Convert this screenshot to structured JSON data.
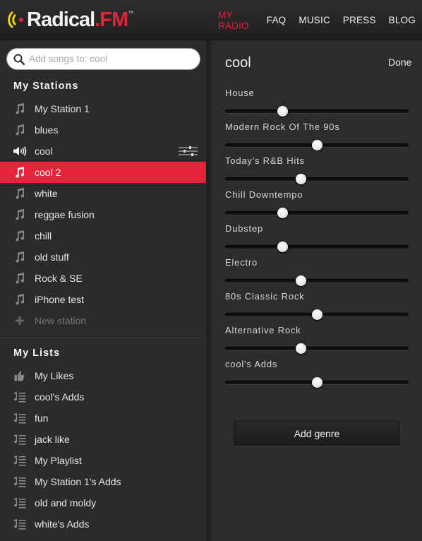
{
  "header": {
    "logo": {
      "name": "Radical",
      "suffix": ".FM",
      "tm": "™"
    },
    "nav": [
      {
        "label": "MY RADIO",
        "active": true
      },
      {
        "label": "FAQ",
        "active": false
      },
      {
        "label": "MUSIC",
        "active": false
      },
      {
        "label": "PRESS",
        "active": false
      },
      {
        "label": "BLOG",
        "active": false
      }
    ]
  },
  "sidebar": {
    "search": {
      "placeholder": "Add songs to: cool",
      "value": ""
    },
    "stations_title": "My Stations",
    "stations": [
      {
        "label": "My Station 1",
        "icon": "music-note-icon"
      },
      {
        "label": "blues",
        "icon": "music-note-icon"
      },
      {
        "label": "cool",
        "icon": "speaker-icon",
        "playing": true
      },
      {
        "label": "cool 2",
        "icon": "music-note-icon",
        "selected": true
      },
      {
        "label": "white",
        "icon": "music-note-icon"
      },
      {
        "label": "reggae fusion",
        "icon": "music-note-icon"
      },
      {
        "label": "chill",
        "icon": "music-note-icon"
      },
      {
        "label": "old stuff",
        "icon": "music-note-icon"
      },
      {
        "label": "Rock & SE",
        "icon": "music-note-icon"
      },
      {
        "label": "iPhone test",
        "icon": "music-note-icon"
      }
    ],
    "new_station_label": "New station",
    "lists_title": "My Lists",
    "lists": [
      {
        "label": "My Likes",
        "icon": "thumbs-up-icon"
      },
      {
        "label": "cool's Adds",
        "icon": "playlist-icon"
      },
      {
        "label": "fun",
        "icon": "playlist-icon"
      },
      {
        "label": "jack like",
        "icon": "playlist-icon"
      },
      {
        "label": "My Playlist",
        "icon": "playlist-icon"
      },
      {
        "label": "My Station 1's Adds",
        "icon": "playlist-icon"
      },
      {
        "label": "old and moldy",
        "icon": "playlist-icon"
      },
      {
        "label": "white's Adds",
        "icon": "playlist-icon"
      }
    ]
  },
  "editor": {
    "title": "cool",
    "done_label": "Done",
    "genres": [
      {
        "label": "House",
        "value": 0.31
      },
      {
        "label": "Modern Rock Of The 90s",
        "value": 0.5
      },
      {
        "label": "Today's R&B Hits",
        "value": 0.41
      },
      {
        "label": "Chill Downtempo",
        "value": 0.31
      },
      {
        "label": "Dubstep",
        "value": 0.31
      },
      {
        "label": "Electro",
        "value": 0.41
      },
      {
        "label": "80s Classic Rock",
        "value": 0.5
      },
      {
        "label": "Alternative Rock",
        "value": 0.41
      },
      {
        "label": "cool's Adds",
        "value": 0.5
      }
    ],
    "add_genre_label": "Add genre"
  },
  "colors": {
    "accent": "#e5233b",
    "background": "#2b2b2b",
    "text": "#e6e6e6"
  }
}
